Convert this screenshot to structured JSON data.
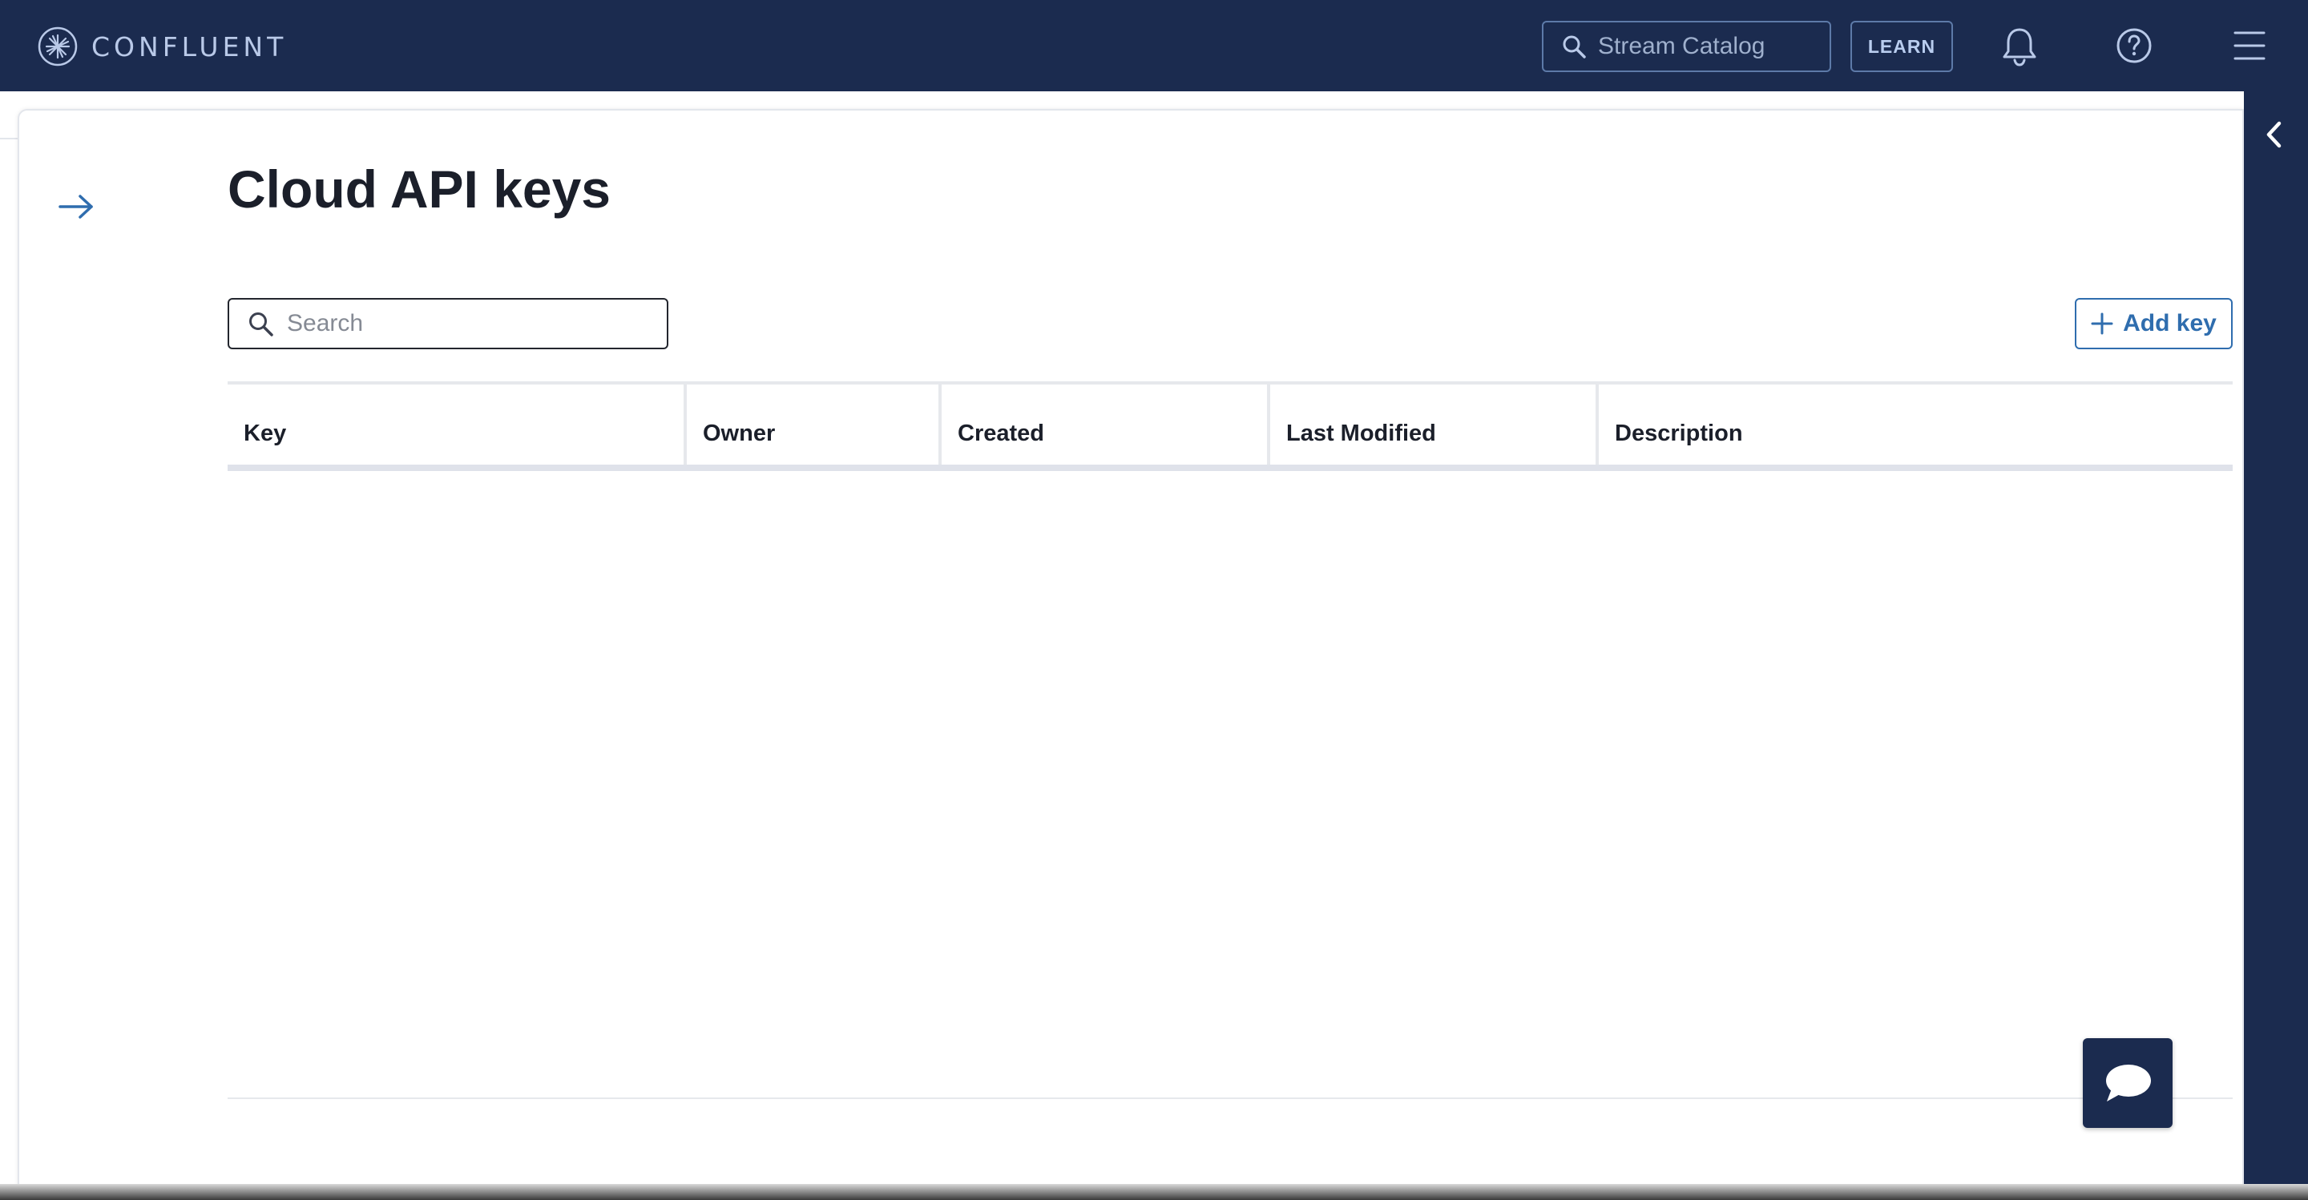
{
  "brand": {
    "name": "CONFLUENT"
  },
  "header": {
    "catalog_search_placeholder": "Stream Catalog",
    "learn_label": "LEARN",
    "icons": [
      "search-icon",
      "bell-icon",
      "help-icon",
      "hamburger-menu-icon"
    ]
  },
  "page": {
    "title": "Cloud API keys",
    "search_placeholder": "Search",
    "add_key_label": "Add key"
  },
  "table": {
    "columns": [
      "Key",
      "Owner",
      "Created",
      "Last Modified",
      "Description"
    ],
    "rows": []
  },
  "colors": {
    "nav_background": "#1b2b4f",
    "accent": "#2f6dae",
    "text": "#1b1f2a"
  }
}
